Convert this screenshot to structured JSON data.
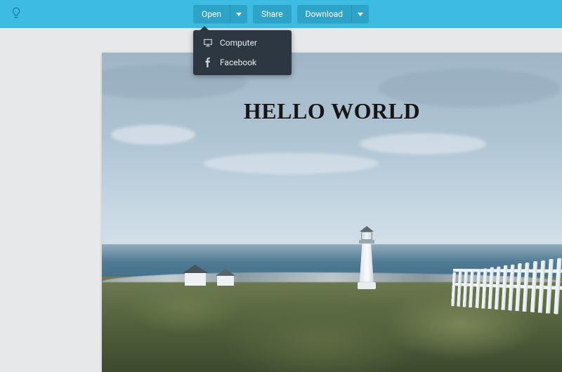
{
  "toolbar": {
    "open_label": "Open",
    "share_label": "Share",
    "download_label": "Download"
  },
  "open_menu": {
    "items": [
      {
        "label": "Computer",
        "icon": "monitor-icon"
      },
      {
        "label": "Facebook",
        "icon": "facebook-icon"
      }
    ]
  },
  "canvas": {
    "headline": "HELLO WORLD"
  },
  "colors": {
    "topbar": "#3ebbe2",
    "button": "#2ea3c8",
    "dropdown": "#2d3741",
    "page_bg": "#e7e8e9"
  }
}
